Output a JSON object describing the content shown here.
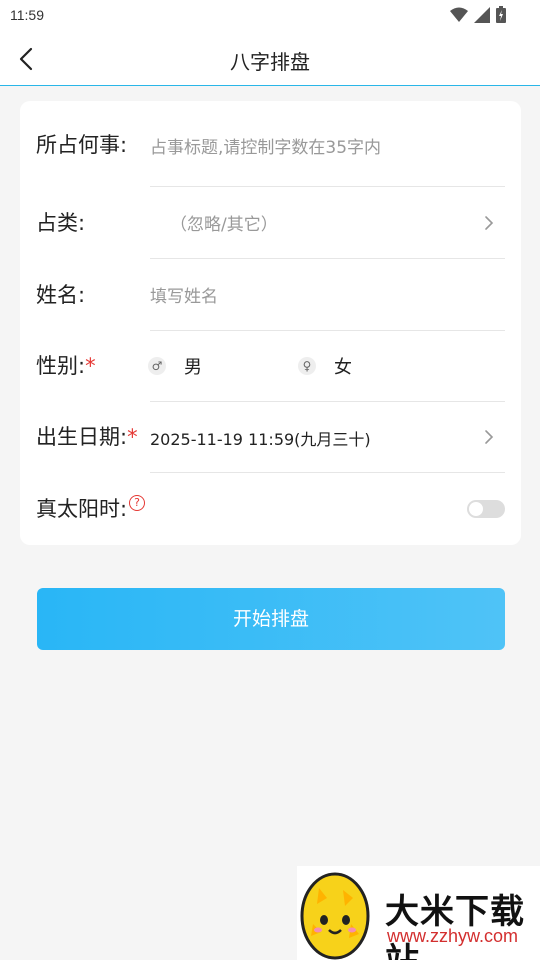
{
  "status_bar": {
    "time": "11:59"
  },
  "header": {
    "title": "八字排盘"
  },
  "form": {
    "matter": {
      "label": "所占何事:",
      "placeholder": "占事标题,请控制字数在35字内"
    },
    "category": {
      "label": "占类:",
      "value": "（忽略/其它）"
    },
    "name": {
      "label": "姓名:",
      "placeholder": "填写姓名"
    },
    "gender": {
      "label": "性别:",
      "required_mark": "*",
      "options": [
        {
          "label": "男",
          "icon": "male-icon"
        },
        {
          "label": "女",
          "icon": "female-icon"
        }
      ]
    },
    "birth": {
      "label": "出生日期:",
      "required_mark": "*",
      "value": "2025-11-19 11:59(九月三十)"
    },
    "solar_time": {
      "label": "真太阳时:",
      "help": "?",
      "enabled": false
    }
  },
  "start_button": {
    "label": "开始排盘"
  },
  "colors": {
    "accent": "#29b6f6",
    "required": "#e53935",
    "divider": "#29b6e8"
  },
  "watermark": {
    "title": "大米下载站",
    "url": "www.zzhyw.com"
  }
}
